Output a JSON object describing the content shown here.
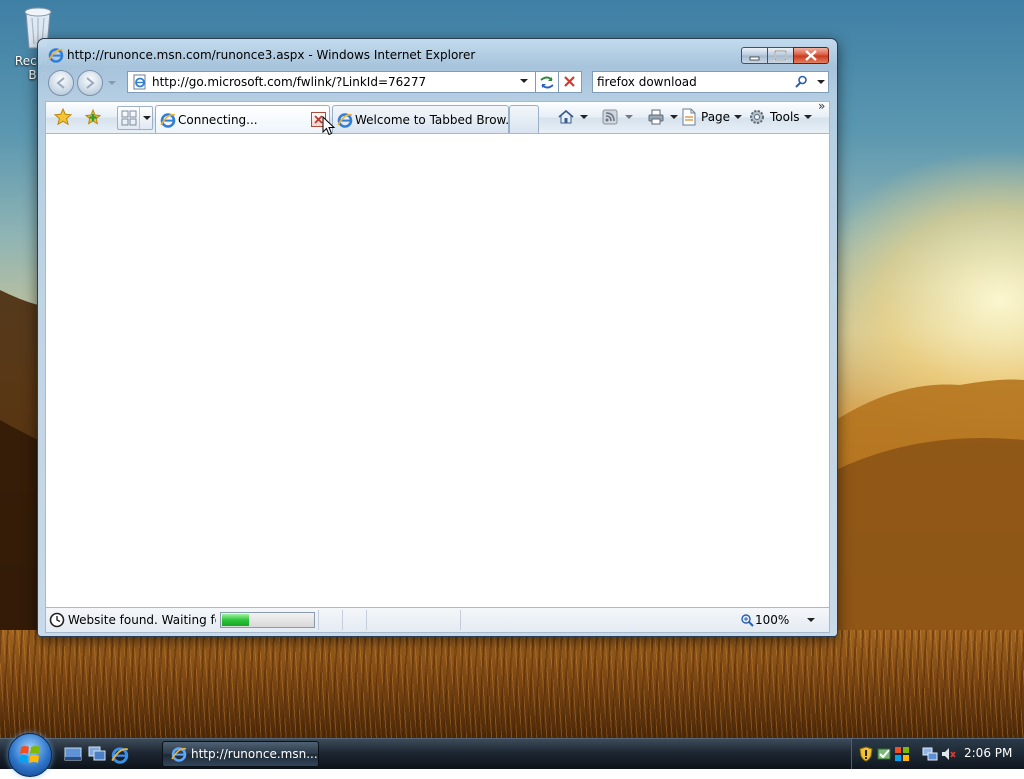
{
  "desktop": {
    "recycle_bin_label": "Recycle Bin"
  },
  "window": {
    "title": "http://runonce.msn.com/runonce3.aspx - Windows Internet Explorer",
    "icon": "ie-icon",
    "controls": [
      "minimize-icon",
      "maximize-icon",
      "close-icon"
    ]
  },
  "navigation": {
    "back_icon": "back-arrow-icon",
    "forward_icon": "forward-arrow-icon",
    "address": "http://go.microsoft.com/fwlink/?LinkId=76277",
    "refresh_icon": "refresh-icon",
    "stop_icon": "stop-icon"
  },
  "search": {
    "value": "firefox download",
    "icon": "search-icon"
  },
  "tabs": [
    {
      "label": "Connecting...",
      "active": true
    },
    {
      "label": "Welcome to Tabbed Brow...",
      "active": false
    }
  ],
  "commands": {
    "page_label": "Page",
    "tools_label": "Tools",
    "overflow": "»"
  },
  "status": {
    "text": "Website found. Waiting for reply...",
    "progress": 0.3,
    "zoom": "100%"
  },
  "taskbar": {
    "task_label": "http://runonce.msn...",
    "clock": "2:06 PM"
  },
  "colors": {
    "title_glass": "#bcd3e8",
    "progress_green": "#2cc43a",
    "close_red": "#d9533a",
    "taskbar": "#1d2732"
  }
}
